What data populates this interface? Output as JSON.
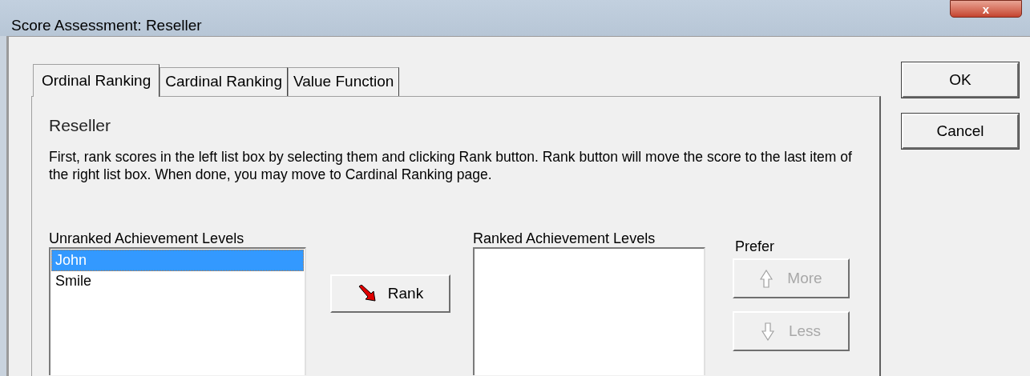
{
  "window": {
    "title": "Score Assessment: Reseller",
    "close_label": "x"
  },
  "tabs": [
    {
      "label": "Ordinal Ranking",
      "selected": true
    },
    {
      "label": "Cardinal Ranking",
      "selected": false
    },
    {
      "label": "Value Function",
      "selected": false
    }
  ],
  "heading": "Reseller",
  "instructions": "First, rank scores in the left list box by selecting them and clicking Rank button. Rank button will move the score to the last item of the right list box. When done, you may move to Cardinal Ranking page.",
  "unranked": {
    "label": "Unranked Achievement Levels",
    "items": [
      {
        "text": "John",
        "selected": true
      },
      {
        "text": "Smile",
        "selected": false
      }
    ]
  },
  "rank_button": {
    "label": "Rank",
    "disabled": false
  },
  "ranked": {
    "label": "Ranked Achievement Levels"
  },
  "prefer": {
    "label": "Prefer",
    "buttons": [
      {
        "kind": "up",
        "label": "More",
        "disabled": true
      },
      {
        "kind": "down",
        "label": "Less",
        "disabled": true
      }
    ]
  },
  "dialog_buttons": [
    {
      "label": "OK"
    },
    {
      "label": "Cancel"
    }
  ]
}
